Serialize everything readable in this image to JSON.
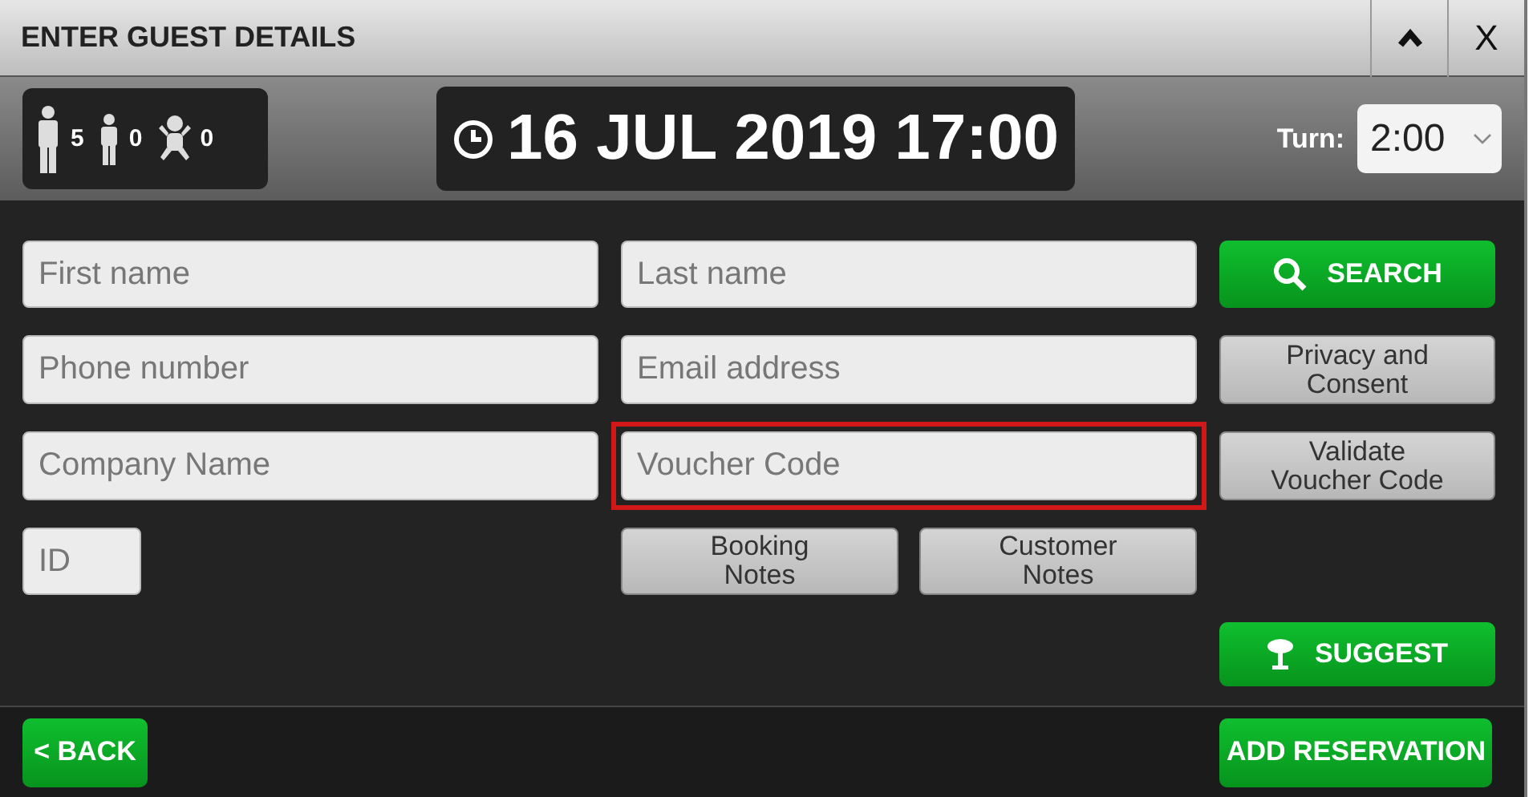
{
  "window": {
    "title": "ENTER GUEST DETAILS",
    "close_label": "X"
  },
  "party": [
    {
      "kind": "adult",
      "count": "5"
    },
    {
      "kind": "child",
      "count": "0"
    },
    {
      "kind": "baby",
      "count": "0"
    }
  ],
  "date": "16 JUL 2019 17:00",
  "turn": {
    "label": "Turn:",
    "value": "2:00"
  },
  "fields": {
    "first_name": {
      "placeholder": "First name",
      "highlighted": false
    },
    "last_name": {
      "placeholder": "Last name",
      "highlighted": false
    },
    "phone": {
      "placeholder": "Phone number",
      "highlighted": false
    },
    "email": {
      "placeholder": "Email address",
      "highlighted": false
    },
    "company": {
      "placeholder": "Company Name",
      "highlighted": false
    },
    "voucher": {
      "placeholder": "Voucher Code",
      "highlighted": true
    },
    "id": {
      "placeholder": "ID",
      "highlighted": false
    }
  },
  "buttons": {
    "search": "SEARCH",
    "privacy": "Privacy and Consent",
    "validate": "Validate Voucher Code",
    "booking_notes": "Booking Notes",
    "customer_notes": "Customer Notes",
    "suggest": "SUGGEST"
  },
  "footer": {
    "back": "< BACK",
    "add": "ADD RESERVATION"
  }
}
